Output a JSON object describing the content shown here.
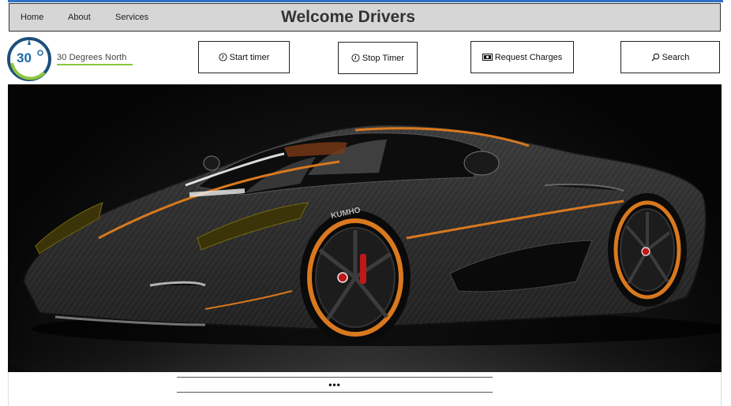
{
  "nav": {
    "items": [
      {
        "label": "Home"
      },
      {
        "label": "About"
      },
      {
        "label": "Services"
      }
    ],
    "title": "Welcome Drivers"
  },
  "logo": {
    "mark": "30",
    "name": "30 Degrees North",
    "accent_color": "#1c6aa8",
    "green_color": "#8cc63f"
  },
  "toolbar": {
    "start_timer": "Start timer",
    "stop_timer": "Stop Timer",
    "request_charges": "Request Charges",
    "search": "Search"
  },
  "icons": {
    "start_timer": "clock-icon",
    "stop_timer": "clock-icon",
    "request_charges": "money-icon",
    "search": "search-icon"
  },
  "hero": {
    "subject": "black carbon-fiber sports car with orange accents",
    "car_text": "KUMHO"
  },
  "carousel": {
    "indicator": "•••"
  }
}
